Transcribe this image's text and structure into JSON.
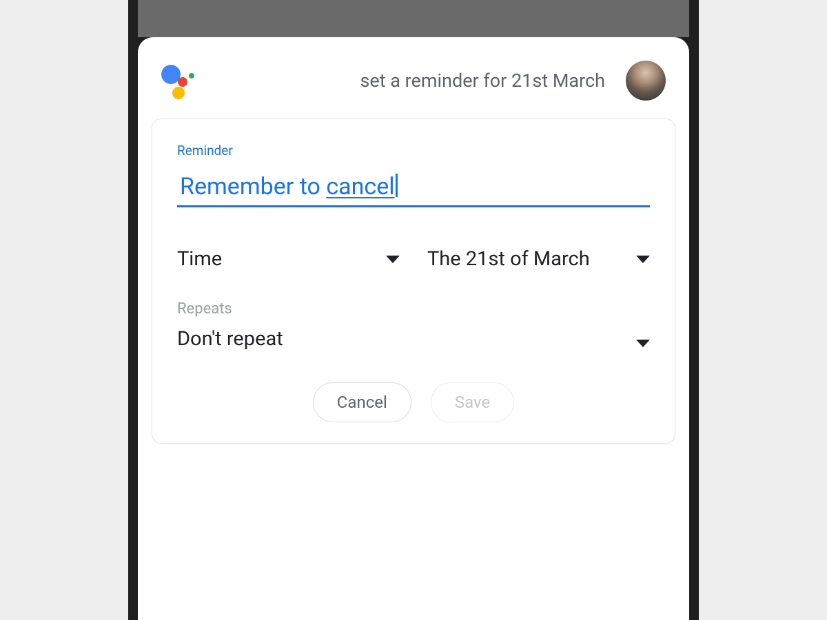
{
  "header": {
    "query": "set a reminder for 21st March"
  },
  "card": {
    "field_label": "Reminder",
    "reminder_text_prefix": "Remember to ",
    "reminder_text_word": "cancel",
    "time_dropdown": "Time",
    "date_dropdown": "The 21st of March",
    "repeats_label": "Repeats",
    "repeats_value": "Don't repeat",
    "cancel_label": "Cancel",
    "save_label": "Save"
  }
}
